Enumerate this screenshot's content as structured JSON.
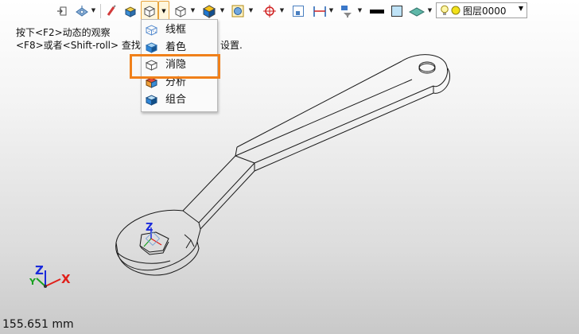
{
  "toolbar": {
    "layer_label": "图层0000",
    "icons": [
      "import-icon",
      "view-orient-icon",
      "paint-icon",
      "render-style-icon",
      "display-mode-icon",
      "view-cube-icon",
      "shaded-cube-icon",
      "zoom-fit-icon",
      "center-icon",
      "frame-icon",
      "measure-icon",
      "filter-icon",
      "line-color-icon",
      "fill-color-icon",
      "plane-icon",
      "bulb-icon",
      "layer-icon"
    ]
  },
  "hint": {
    "line1": "按下<F2>动态的观察",
    "line2_left": "<F8>或者<Shift-roll> 查找下-",
    "line2_right": "设置."
  },
  "display_menu": {
    "items": [
      {
        "label": "线框",
        "icon": "wireframe-cube-icon"
      },
      {
        "label": "着色",
        "icon": "shaded-cube-icon"
      },
      {
        "label": "消隐",
        "icon": "hidden-line-cube-icon"
      },
      {
        "label": "分析",
        "icon": "analysis-cube-icon"
      },
      {
        "label": "组合",
        "icon": "combined-cube-icon"
      }
    ],
    "highlighted": "消隐",
    "highlight_color": "#f0801a"
  },
  "axes": {
    "x": "X",
    "y": "Y",
    "z": "Z",
    "x_color": "#e0201a",
    "y_color": "#18a020",
    "z_color": "#1a2adc"
  },
  "scale_readout": "155.651 mm"
}
